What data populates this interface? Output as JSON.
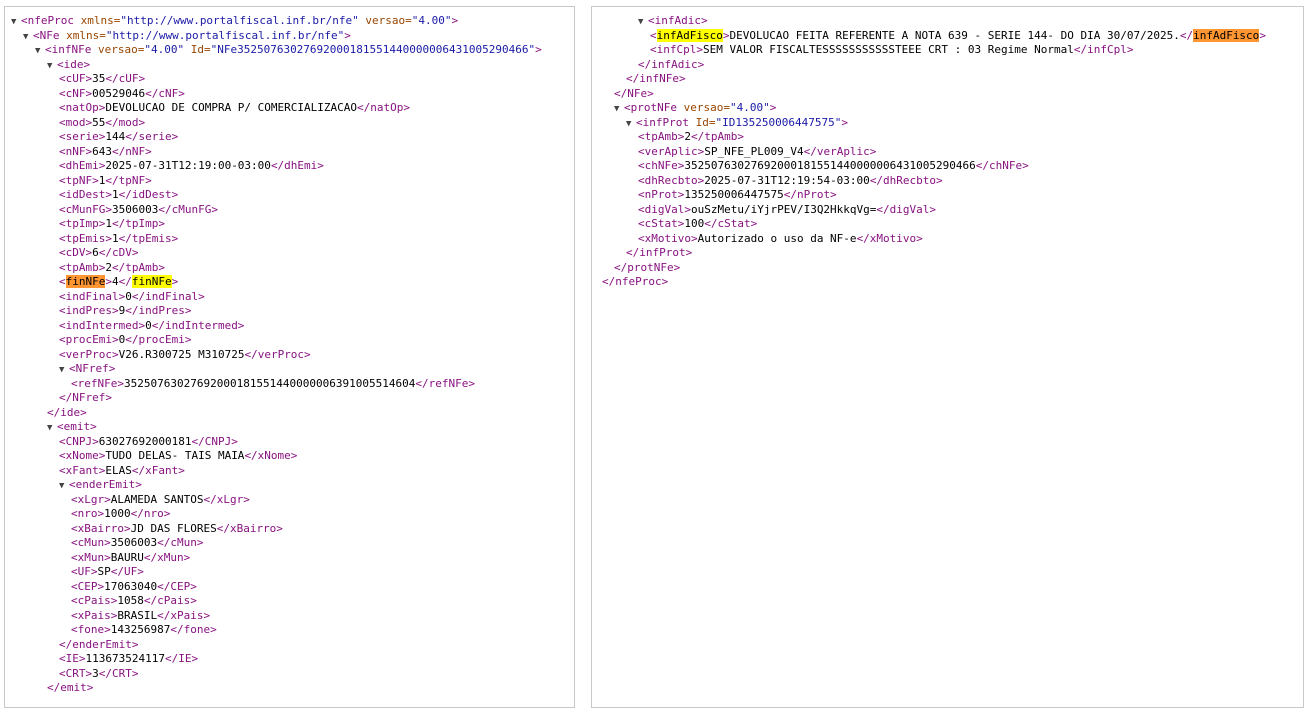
{
  "colors": {
    "tag": "#881280",
    "attribute_name": "#994500",
    "attribute_value": "#1a1aa6",
    "text": "#000000",
    "highlight_current": "#ff9632",
    "highlight_match": "#ffff00",
    "border": "#c8c8c8"
  },
  "left_pane": {
    "lines": [
      {
        "indent": 0,
        "toggle": true,
        "parts": [
          {
            "t": "<nfeProc",
            "c": "tag"
          },
          {
            "t": " xmlns=",
            "c": "att"
          },
          {
            "t": "\"http://www.portalfiscal.inf.br/nfe\"",
            "c": "val"
          },
          {
            "t": " versao=",
            "c": "att"
          },
          {
            "t": "\"4.00\"",
            "c": "val"
          },
          {
            "t": ">",
            "c": "tag"
          }
        ]
      },
      {
        "indent": 1,
        "toggle": true,
        "parts": [
          {
            "t": "<NFe",
            "c": "tag"
          },
          {
            "t": " xmlns=",
            "c": "att"
          },
          {
            "t": "\"http://www.portalfiscal.inf.br/nfe\"",
            "c": "val"
          },
          {
            "t": ">",
            "c": "tag"
          }
        ]
      },
      {
        "indent": 2,
        "toggle": true,
        "parts": [
          {
            "t": "<infNFe",
            "c": "tag"
          },
          {
            "t": " versao=",
            "c": "att"
          },
          {
            "t": "\"4.00\"",
            "c": "val"
          },
          {
            "t": " Id=",
            "c": "att"
          },
          {
            "t": "\"NFe35250763027692000181551440000006431005290466\"",
            "c": "val"
          },
          {
            "t": ">",
            "c": "tag"
          }
        ]
      },
      {
        "indent": 3,
        "toggle": true,
        "parts": [
          {
            "t": "<ide>",
            "c": "tag"
          }
        ]
      },
      {
        "indent": 4,
        "parts": [
          {
            "t": "<cUF>",
            "c": "tag"
          },
          {
            "t": "35",
            "c": "txt"
          },
          {
            "t": "</cUF>",
            "c": "tag"
          }
        ]
      },
      {
        "indent": 4,
        "parts": [
          {
            "t": "<cNF>",
            "c": "tag"
          },
          {
            "t": "00529046",
            "c": "txt"
          },
          {
            "t": "</cNF>",
            "c": "tag"
          }
        ]
      },
      {
        "indent": 4,
        "parts": [
          {
            "t": "<natOp>",
            "c": "tag"
          },
          {
            "t": "DEVOLUCAO DE COMPRA P/ COMERCIALIZACAO",
            "c": "txt"
          },
          {
            "t": "</natOp>",
            "c": "tag"
          }
        ]
      },
      {
        "indent": 4,
        "parts": [
          {
            "t": "<mod>",
            "c": "tag"
          },
          {
            "t": "55",
            "c": "txt"
          },
          {
            "t": "</mod>",
            "c": "tag"
          }
        ]
      },
      {
        "indent": 4,
        "parts": [
          {
            "t": "<serie>",
            "c": "tag"
          },
          {
            "t": "144",
            "c": "txt"
          },
          {
            "t": "</serie>",
            "c": "tag"
          }
        ]
      },
      {
        "indent": 4,
        "parts": [
          {
            "t": "<nNF>",
            "c": "tag"
          },
          {
            "t": "643",
            "c": "txt"
          },
          {
            "t": "</nNF>",
            "c": "tag"
          }
        ]
      },
      {
        "indent": 4,
        "parts": [
          {
            "t": "<dhEmi>",
            "c": "tag"
          },
          {
            "t": "2025-07-31T12:19:00-03:00",
            "c": "txt"
          },
          {
            "t": "</dhEmi>",
            "c": "tag"
          }
        ]
      },
      {
        "indent": 4,
        "parts": [
          {
            "t": "<tpNF>",
            "c": "tag"
          },
          {
            "t": "1",
            "c": "txt"
          },
          {
            "t": "</tpNF>",
            "c": "tag"
          }
        ]
      },
      {
        "indent": 4,
        "parts": [
          {
            "t": "<idDest>",
            "c": "tag"
          },
          {
            "t": "1",
            "c": "txt"
          },
          {
            "t": "</idDest>",
            "c": "tag"
          }
        ]
      },
      {
        "indent": 4,
        "parts": [
          {
            "t": "<cMunFG>",
            "c": "tag"
          },
          {
            "t": "3506003",
            "c": "txt"
          },
          {
            "t": "</cMunFG>",
            "c": "tag"
          }
        ]
      },
      {
        "indent": 4,
        "parts": [
          {
            "t": "<tpImp>",
            "c": "tag"
          },
          {
            "t": "1",
            "c": "txt"
          },
          {
            "t": "</tpImp>",
            "c": "tag"
          }
        ]
      },
      {
        "indent": 4,
        "parts": [
          {
            "t": "<tpEmis>",
            "c": "tag"
          },
          {
            "t": "1",
            "c": "txt"
          },
          {
            "t": "</tpEmis>",
            "c": "tag"
          }
        ]
      },
      {
        "indent": 4,
        "parts": [
          {
            "t": "<cDV>",
            "c": "tag"
          },
          {
            "t": "6",
            "c": "txt"
          },
          {
            "t": "</cDV>",
            "c": "tag"
          }
        ]
      },
      {
        "indent": 4,
        "parts": [
          {
            "t": "<tpAmb>",
            "c": "tag"
          },
          {
            "t": "2",
            "c": "txt"
          },
          {
            "t": "</tpAmb>",
            "c": "tag"
          }
        ]
      },
      {
        "indent": 4,
        "parts": [
          {
            "t": "<",
            "c": "tag"
          },
          {
            "t": "finNFe",
            "c": "hl-orange"
          },
          {
            "t": ">",
            "c": "tag"
          },
          {
            "t": "4",
            "c": "txt"
          },
          {
            "t": "</",
            "c": "tag"
          },
          {
            "t": "finNFe",
            "c": "hl-yellow"
          },
          {
            "t": ">",
            "c": "tag"
          }
        ]
      },
      {
        "indent": 4,
        "parts": [
          {
            "t": "<indFinal>",
            "c": "tag"
          },
          {
            "t": "0",
            "c": "txt"
          },
          {
            "t": "</indFinal>",
            "c": "tag"
          }
        ]
      },
      {
        "indent": 4,
        "parts": [
          {
            "t": "<indPres>",
            "c": "tag"
          },
          {
            "t": "9",
            "c": "txt"
          },
          {
            "t": "</indPres>",
            "c": "tag"
          }
        ]
      },
      {
        "indent": 4,
        "parts": [
          {
            "t": "<indIntermed>",
            "c": "tag"
          },
          {
            "t": "0",
            "c": "txt"
          },
          {
            "t": "</indIntermed>",
            "c": "tag"
          }
        ]
      },
      {
        "indent": 4,
        "parts": [
          {
            "t": "<procEmi>",
            "c": "tag"
          },
          {
            "t": "0",
            "c": "txt"
          },
          {
            "t": "</procEmi>",
            "c": "tag"
          }
        ]
      },
      {
        "indent": 4,
        "parts": [
          {
            "t": "<verProc>",
            "c": "tag"
          },
          {
            "t": "V26.R300725 M310725",
            "c": "txt"
          },
          {
            "t": "</verProc>",
            "c": "tag"
          }
        ]
      },
      {
        "indent": 4,
        "toggle": true,
        "parts": [
          {
            "t": "<NFref>",
            "c": "tag"
          }
        ]
      },
      {
        "indent": 5,
        "parts": [
          {
            "t": "<refNFe>",
            "c": "tag"
          },
          {
            "t": "35250763027692000181551440000006391005514604",
            "c": "txt"
          },
          {
            "t": "</refNFe>",
            "c": "tag"
          }
        ]
      },
      {
        "indent": 4,
        "parts": [
          {
            "t": "</NFref>",
            "c": "tag"
          }
        ]
      },
      {
        "indent": 3,
        "parts": [
          {
            "t": "</ide>",
            "c": "tag"
          }
        ]
      },
      {
        "indent": 3,
        "toggle": true,
        "parts": [
          {
            "t": "<emit>",
            "c": "tag"
          }
        ]
      },
      {
        "indent": 4,
        "parts": [
          {
            "t": "<CNPJ>",
            "c": "tag"
          },
          {
            "t": "63027692000181",
            "c": "txt"
          },
          {
            "t": "</CNPJ>",
            "c": "tag"
          }
        ]
      },
      {
        "indent": 4,
        "parts": [
          {
            "t": "<xNome>",
            "c": "tag"
          },
          {
            "t": "TUDO DELAS- TAIS MAIA",
            "c": "txt"
          },
          {
            "t": "</xNome>",
            "c": "tag"
          }
        ]
      },
      {
        "indent": 4,
        "parts": [
          {
            "t": "<xFant>",
            "c": "tag"
          },
          {
            "t": "ELAS",
            "c": "txt"
          },
          {
            "t": "</xFant>",
            "c": "tag"
          }
        ]
      },
      {
        "indent": 4,
        "toggle": true,
        "parts": [
          {
            "t": "<enderEmit>",
            "c": "tag"
          }
        ]
      },
      {
        "indent": 5,
        "parts": [
          {
            "t": "<xLgr>",
            "c": "tag"
          },
          {
            "t": "ALAMEDA SANTOS",
            "c": "txt"
          },
          {
            "t": "</xLgr>",
            "c": "tag"
          }
        ]
      },
      {
        "indent": 5,
        "parts": [
          {
            "t": "<nro>",
            "c": "tag"
          },
          {
            "t": "1000",
            "c": "txt"
          },
          {
            "t": "</nro>",
            "c": "tag"
          }
        ]
      },
      {
        "indent": 5,
        "parts": [
          {
            "t": "<xBairro>",
            "c": "tag"
          },
          {
            "t": "JD DAS FLORES",
            "c": "txt"
          },
          {
            "t": "</xBairro>",
            "c": "tag"
          }
        ]
      },
      {
        "indent": 5,
        "parts": [
          {
            "t": "<cMun>",
            "c": "tag"
          },
          {
            "t": "3506003",
            "c": "txt"
          },
          {
            "t": "</cMun>",
            "c": "tag"
          }
        ]
      },
      {
        "indent": 5,
        "parts": [
          {
            "t": "<xMun>",
            "c": "tag"
          },
          {
            "t": "BAURU",
            "c": "txt"
          },
          {
            "t": "</xMun>",
            "c": "tag"
          }
        ]
      },
      {
        "indent": 5,
        "parts": [
          {
            "t": "<UF>",
            "c": "tag"
          },
          {
            "t": "SP",
            "c": "txt"
          },
          {
            "t": "</UF>",
            "c": "tag"
          }
        ]
      },
      {
        "indent": 5,
        "parts": [
          {
            "t": "<CEP>",
            "c": "tag"
          },
          {
            "t": "17063040",
            "c": "txt"
          },
          {
            "t": "</CEP>",
            "c": "tag"
          }
        ]
      },
      {
        "indent": 5,
        "parts": [
          {
            "t": "<cPais>",
            "c": "tag"
          },
          {
            "t": "1058",
            "c": "txt"
          },
          {
            "t": "</cPais>",
            "c": "tag"
          }
        ]
      },
      {
        "indent": 5,
        "parts": [
          {
            "t": "<xPais>",
            "c": "tag"
          },
          {
            "t": "BRASIL",
            "c": "txt"
          },
          {
            "t": "</xPais>",
            "c": "tag"
          }
        ]
      },
      {
        "indent": 5,
        "parts": [
          {
            "t": "<fone>",
            "c": "tag"
          },
          {
            "t": "143256987",
            "c": "txt"
          },
          {
            "t": "</fone>",
            "c": "tag"
          }
        ]
      },
      {
        "indent": 4,
        "parts": [
          {
            "t": "</enderEmit>",
            "c": "tag"
          }
        ]
      },
      {
        "indent": 4,
        "parts": [
          {
            "t": "<IE>",
            "c": "tag"
          },
          {
            "t": "113673524117",
            "c": "txt"
          },
          {
            "t": "</IE>",
            "c": "tag"
          }
        ]
      },
      {
        "indent": 4,
        "parts": [
          {
            "t": "<CRT>",
            "c": "tag"
          },
          {
            "t": "3",
            "c": "txt"
          },
          {
            "t": "</CRT>",
            "c": "tag"
          }
        ]
      },
      {
        "indent": 3,
        "parts": [
          {
            "t": "</emit>",
            "c": "tag"
          }
        ]
      }
    ]
  },
  "right_pane": {
    "lines": [
      {
        "indent": 3,
        "toggle": true,
        "parts": [
          {
            "t": "<infAdic>",
            "c": "tag"
          }
        ]
      },
      {
        "indent": 4,
        "parts": [
          {
            "t": "<",
            "c": "tag"
          },
          {
            "t": "infAdFisco",
            "c": "hl-yellow"
          },
          {
            "t": ">",
            "c": "tag"
          },
          {
            "t": "DEVOLUCAO FEITA REFERENTE A NOTA 639 - SERIE 144- DO DIA 30/07/2025.",
            "c": "txt"
          },
          {
            "t": "</",
            "c": "tag"
          },
          {
            "t": "infAdFisco",
            "c": "hl-orange"
          },
          {
            "t": ">",
            "c": "tag"
          }
        ]
      },
      {
        "indent": 4,
        "parts": [
          {
            "t": "<infCpl>",
            "c": "tag"
          },
          {
            "t": "SEM VALOR FISCALTESSSSSSSSSSSTEEE CRT : 03 Regime Normal",
            "c": "txt"
          },
          {
            "t": "</infCpl>",
            "c": "tag"
          }
        ]
      },
      {
        "indent": 3,
        "parts": [
          {
            "t": "</infAdic>",
            "c": "tag"
          }
        ]
      },
      {
        "indent": 2,
        "parts": [
          {
            "t": "</infNFe>",
            "c": "tag"
          }
        ]
      },
      {
        "indent": 1,
        "parts": [
          {
            "t": "</NFe>",
            "c": "tag"
          }
        ]
      },
      {
        "indent": 1,
        "toggle": true,
        "parts": [
          {
            "t": "<protNFe",
            "c": "tag"
          },
          {
            "t": " versao=",
            "c": "att"
          },
          {
            "t": "\"4.00\"",
            "c": "val"
          },
          {
            "t": ">",
            "c": "tag"
          }
        ]
      },
      {
        "indent": 2,
        "toggle": true,
        "parts": [
          {
            "t": "<infProt",
            "c": "tag"
          },
          {
            "t": " Id=",
            "c": "att"
          },
          {
            "t": "\"ID135250006447575\"",
            "c": "val"
          },
          {
            "t": ">",
            "c": "tag"
          }
        ]
      },
      {
        "indent": 3,
        "parts": [
          {
            "t": "<tpAmb>",
            "c": "tag"
          },
          {
            "t": "2",
            "c": "txt"
          },
          {
            "t": "</tpAmb>",
            "c": "tag"
          }
        ]
      },
      {
        "indent": 3,
        "parts": [
          {
            "t": "<verAplic>",
            "c": "tag"
          },
          {
            "t": "SP_NFE_PL009_V4",
            "c": "txt"
          },
          {
            "t": "</verAplic>",
            "c": "tag"
          }
        ]
      },
      {
        "indent": 3,
        "parts": [
          {
            "t": "<chNFe>",
            "c": "tag"
          },
          {
            "t": "35250763027692000181551440000006431005290466",
            "c": "txt"
          },
          {
            "t": "</chNFe>",
            "c": "tag"
          }
        ]
      },
      {
        "indent": 3,
        "parts": [
          {
            "t": "<dhRecbto>",
            "c": "tag"
          },
          {
            "t": "2025-07-31T12:19:54-03:00",
            "c": "txt"
          },
          {
            "t": "</dhRecbto>",
            "c": "tag"
          }
        ]
      },
      {
        "indent": 3,
        "parts": [
          {
            "t": "<nProt>",
            "c": "tag"
          },
          {
            "t": "135250006447575",
            "c": "txt"
          },
          {
            "t": "</nProt>",
            "c": "tag"
          }
        ]
      },
      {
        "indent": 3,
        "parts": [
          {
            "t": "<digVal>",
            "c": "tag"
          },
          {
            "t": "ouSzMetu/iYjrPEV/I3Q2HkkqVg=",
            "c": "txt"
          },
          {
            "t": "</digVal>",
            "c": "tag"
          }
        ]
      },
      {
        "indent": 3,
        "parts": [
          {
            "t": "<cStat>",
            "c": "tag"
          },
          {
            "t": "100",
            "c": "txt"
          },
          {
            "t": "</cStat>",
            "c": "tag"
          }
        ]
      },
      {
        "indent": 3,
        "parts": [
          {
            "t": "<xMotivo>",
            "c": "tag"
          },
          {
            "t": "Autorizado o uso da NF-e",
            "c": "txt"
          },
          {
            "t": "</xMotivo>",
            "c": "tag"
          }
        ]
      },
      {
        "indent": 2,
        "parts": [
          {
            "t": "</infProt>",
            "c": "tag"
          }
        ]
      },
      {
        "indent": 1,
        "parts": [
          {
            "t": "</protNFe>",
            "c": "tag"
          }
        ]
      },
      {
        "indent": 0,
        "parts": [
          {
            "t": "</nfeProc>",
            "c": "tag"
          }
        ]
      }
    ]
  }
}
